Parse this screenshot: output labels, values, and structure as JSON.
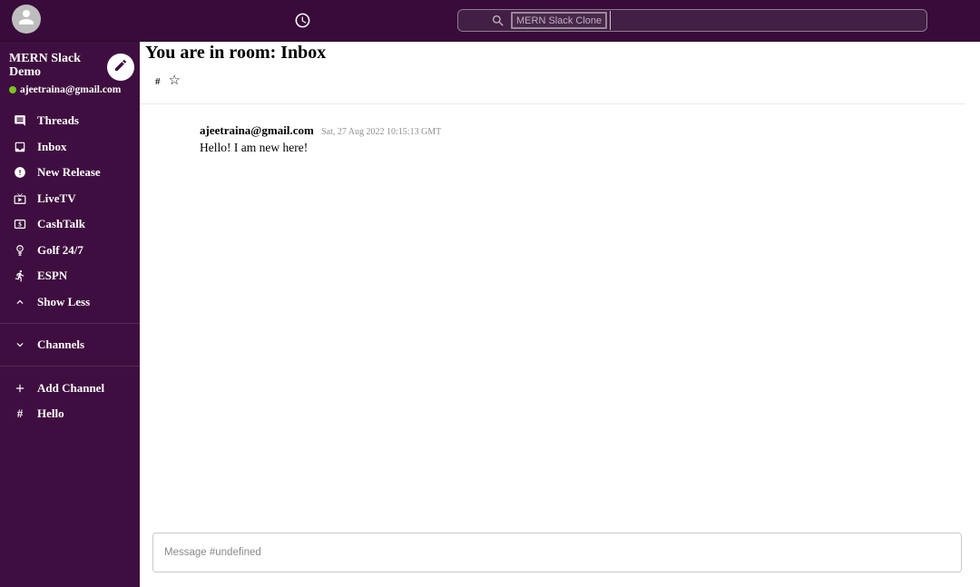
{
  "colors": {
    "header_bg": "#380b3a",
    "sidebar_bg": "#3f0e40",
    "search_bg": "#421f44",
    "presence_green": "#7cc41d",
    "avatar_gray": "#bdbdbd"
  },
  "top_bar": {
    "avatar_icon": "person-icon",
    "clock_icon": "clock-icon",
    "search_icon": "search-icon",
    "search_value": "",
    "search_placeholder": "MERN Slack Clone"
  },
  "sidebar": {
    "workspace_name": "MERN Slack Demo",
    "user_email": "ajeetraina@gmail.com",
    "edit_icon": "pencil-icon",
    "items": [
      {
        "label": "Threads",
        "icon": "comment-icon"
      },
      {
        "label": "Inbox",
        "icon": "inbox-icon"
      },
      {
        "label": "New Release",
        "icon": "new-release-icon"
      },
      {
        "label": "LiveTV",
        "icon": "live-tv-icon"
      },
      {
        "label": "CashTalk",
        "icon": "cash-icon"
      },
      {
        "label": "Golf 24/7",
        "icon": "golf-icon"
      },
      {
        "label": "ESPN",
        "icon": "sports-icon"
      },
      {
        "label": "Show Less",
        "icon": "chevron-up-icon"
      }
    ],
    "channels_header": {
      "label": "Channels",
      "icon": "chevron-down-icon"
    },
    "add_channel": {
      "label": "Add Channel",
      "icon": "plus-icon"
    },
    "channels": [
      {
        "prefix": "#",
        "label": "Hello"
      }
    ]
  },
  "chat": {
    "room_title": "You are in room: Inbox",
    "hash_icon": "#",
    "star_icon": "☆",
    "messages": [
      {
        "user": "ajeetraina@gmail.com",
        "timestamp": "Sat, 27 Aug 2022 10:15:13 GMT",
        "text": "Hello! I am new here!"
      }
    ],
    "input_placeholder": "Message #undefined"
  }
}
